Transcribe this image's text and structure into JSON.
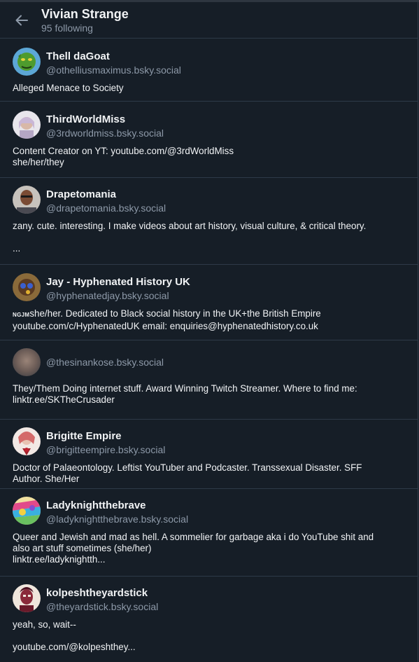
{
  "header": {
    "title": "Vivian Strange",
    "subtitle": "95 following"
  },
  "users": [
    {
      "name": "Thell daGoat",
      "handle": "@othelliusmaximus.bsky.social",
      "bio": "Alleged Menace to Society"
    },
    {
      "name": "ThirdWorldMiss",
      "handle": "@3rdworldmiss.bsky.social",
      "bio": "Content Creator on YT: youtube.com/@3rdWorldMiss\nshe/her/they"
    },
    {
      "name": "Drapetomania",
      "handle": "@drapetomania.bsky.social",
      "bio": "zany. cute. interesting. I make videos about art history, visual culture, & critical theory.\n\n..."
    },
    {
      "name": "Jay - Hyphenated History UK",
      "handle": "@hyphenatedjay.bsky.social",
      "bio_prefix": "NGJM",
      "bio": "she/her. Dedicated to Black social history in the UK+the British Empire\nyoutube.com/c/HyphenatedUK email: enquiries@hyphenatedhistory.co.uk"
    },
    {
      "name": "",
      "handle": "@thesinankose.bsky.social",
      "bio": "They/Them Doing internet stuff. Award Winning Twitch Streamer. Where to find me:\nlinktr.ee/SKTheCrusader"
    },
    {
      "name": "Brigitte Empire",
      "handle": "@brigitteempire.bsky.social",
      "bio": "Doctor of Palaeontology. Leftist YouTuber and Podcaster. Transsexual Disaster. SFF\nAuthor. She/Her"
    },
    {
      "name": "Ladyknightthebrave",
      "handle": "@ladyknightthebrave.bsky.social",
      "bio": "Queer and Jewish and mad as hell. A sommelier for garbage aka i do YouTube shit and\nalso art stuff sometimes (she/her)\nlinktr.ee/ladyknightth..."
    },
    {
      "name": "kolpeshtheyardstick",
      "handle": "@theyardstick.bsky.social",
      "bio": "yeah, so, wait--\n\nyoutube.com/@kolpeshthey..."
    }
  ],
  "icons": {
    "back": "arrow-left-icon"
  },
  "colors": {
    "background": "#161e27",
    "border": "#2e3a48",
    "muted_text": "#8d99a8"
  }
}
